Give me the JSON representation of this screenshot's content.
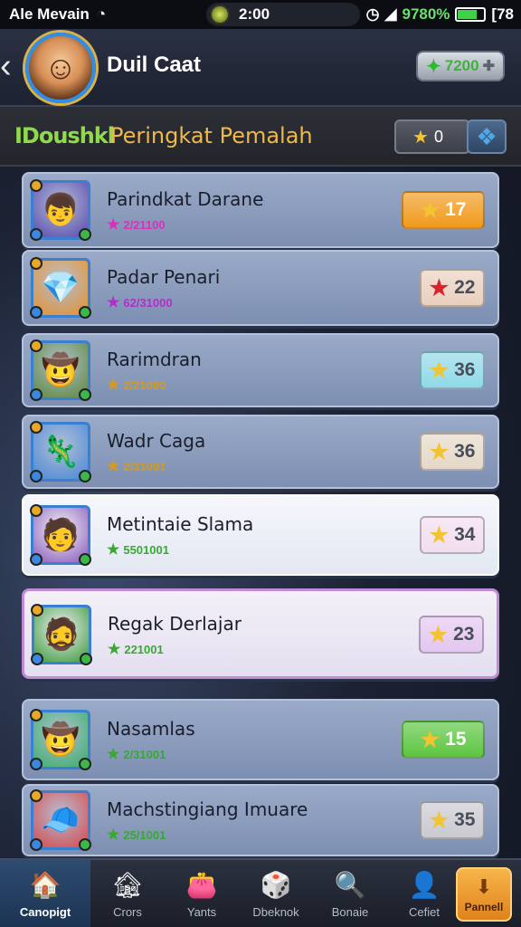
{
  "status_bar": {
    "carrier": "Ale Mevain",
    "time": "2:00",
    "battery_pct": "9780%",
    "extra": "[78"
  },
  "header": {
    "back_icon": "chevron-left-icon",
    "title": "Duil Caat",
    "coins": "7200"
  },
  "subheader": {
    "logo": "IDoushkl",
    "title": "Peringkat Pemalah",
    "stars": "0"
  },
  "players": [
    {
      "name": "Parindkat Darane",
      "sub": "2/21100",
      "score": "17",
      "sub_color": "#d82fbf",
      "score_bg": "#f09a1c",
      "star_color": "#f4c430",
      "thumb_bg": "#5a4ab0",
      "thumb_icon": "👦"
    },
    {
      "name": "Padar Penari",
      "sub": "62/31000",
      "score": "22",
      "sub_color": "#b02fc9",
      "score_bg": "#e9d0bf",
      "star_color": "#d8232a",
      "thumb_bg": "#e8922a",
      "thumb_icon": "💎"
    },
    {
      "name": "Rarimdran",
      "sub": "2/21000",
      "score": "36",
      "sub_color": "#d79a18",
      "score_bg": "#8fd9e8",
      "star_color": "#f4c430",
      "thumb_bg": "#5c8a3a",
      "thumb_icon": "🤠"
    },
    {
      "name": "Wadr Caga",
      "sub": "2/31001",
      "score": "36",
      "sub_color": "#d79a18",
      "score_bg": "#e5d8c8",
      "star_color": "#f4c430",
      "thumb_bg": "#4a8ad8",
      "thumb_icon": "🦎"
    },
    {
      "name": "Metintaie Slama",
      "sub": "5501001",
      "score": "34",
      "sub_color": "#39a832",
      "score_bg": "#f2ddef",
      "star_color": "#f4c430",
      "thumb_bg": "#8a5ab8",
      "thumb_icon": "🧑"
    },
    {
      "name": "Regak Derlajar",
      "sub": "221001",
      "score": "23",
      "sub_color": "#39a832",
      "score_bg": "#e4c6f0",
      "star_color": "#f4c430",
      "thumb_bg": "#3a9a3a",
      "thumb_icon": "🧔"
    },
    {
      "name": "Nasamlas",
      "sub": "2/31001",
      "score": "15",
      "sub_color": "#39a832",
      "score_bg": "#5cc540",
      "star_color": "#f4c430",
      "thumb_bg": "#3ab06a",
      "thumb_icon": "🤠"
    },
    {
      "name": "Machstingiang Imuare",
      "sub": "25/1001",
      "score": "35",
      "sub_color": "#39a832",
      "score_bg": "#c9c9d0",
      "star_color": "#f4c430",
      "thumb_bg": "#d84a4a",
      "thumb_icon": "🧢"
    }
  ],
  "bottom_nav": [
    {
      "label": "Canopigt",
      "icon": "home-icon",
      "glyph": "🏠"
    },
    {
      "label": "Crors",
      "icon": "shop-icon",
      "glyph": "🏚"
    },
    {
      "label": "Yants",
      "icon": "bag-icon",
      "glyph": "👛"
    },
    {
      "label": "Dbeknok",
      "icon": "dice-icon",
      "glyph": "🎲"
    },
    {
      "label": "Bonaie",
      "icon": "search-icon",
      "glyph": "🔍"
    },
    {
      "label": "Cefiet",
      "icon": "profile-icon",
      "glyph": "👤"
    }
  ],
  "special_nav": {
    "label": "Pannell",
    "icon": "download-icon"
  }
}
